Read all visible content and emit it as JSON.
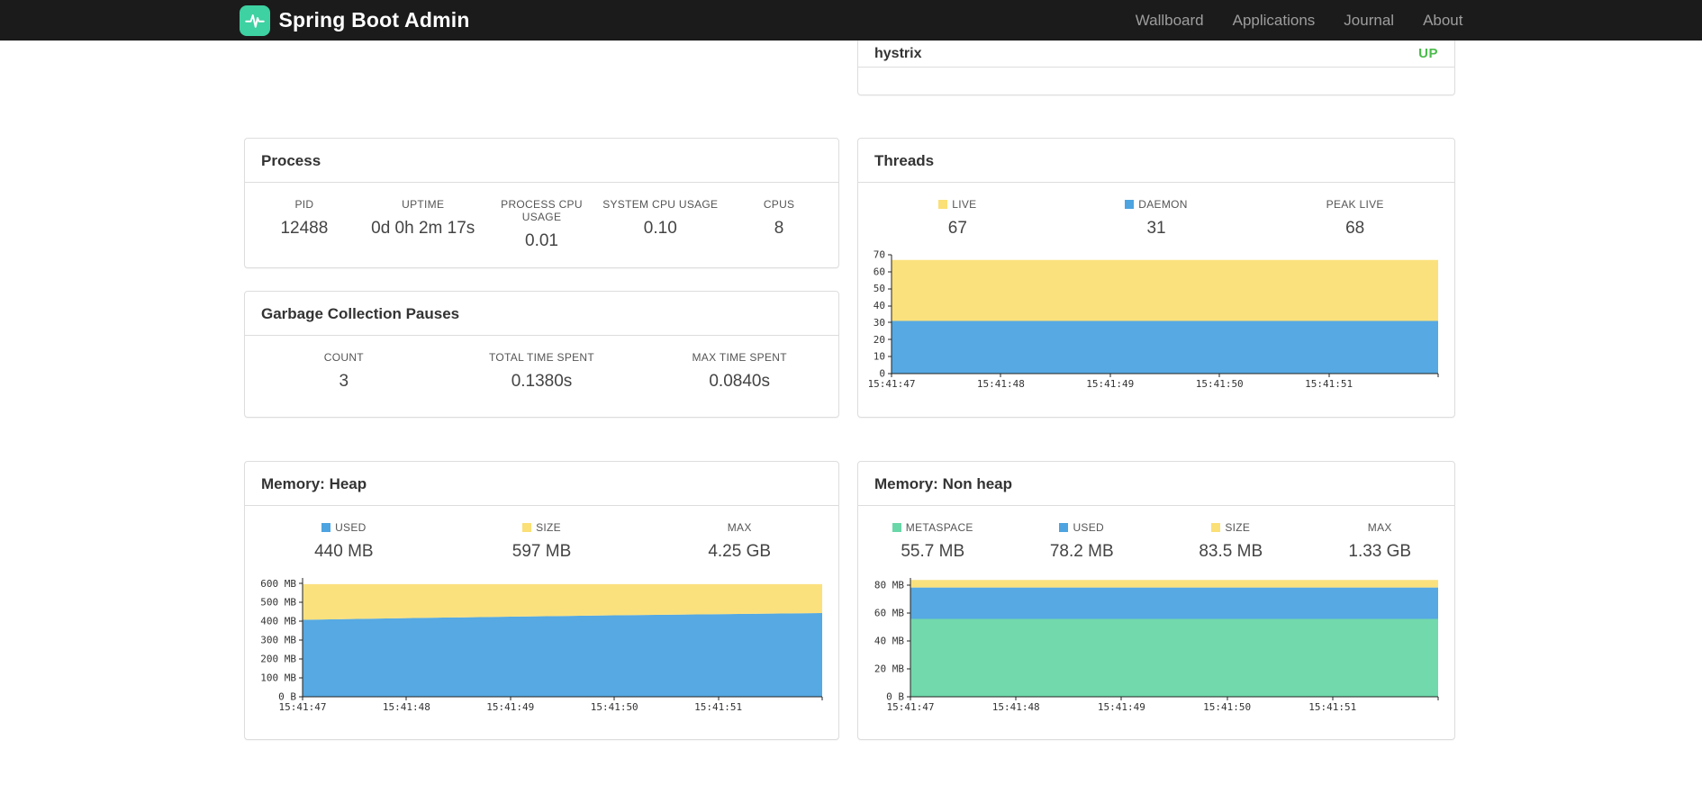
{
  "navbar": {
    "brand": "Spring Boot Admin",
    "items": [
      {
        "id": "wallboard",
        "label": "Wallboard"
      },
      {
        "id": "applications",
        "label": "Applications"
      },
      {
        "id": "journal",
        "label": "Journal"
      },
      {
        "id": "about",
        "label": "About"
      }
    ]
  },
  "colors": {
    "navbar_bg": "#1b1b1b",
    "brand_logo_green": "#3ED1A2",
    "status_up_green": "#4BBB4B",
    "series_blue": "#4DA4E0",
    "series_yellow": "#FBDF77",
    "series_green": "#69D7A8"
  },
  "application_status": {
    "app_name": "hystrix",
    "status": "UP"
  },
  "panels": {
    "process": {
      "title": "Process",
      "stats": [
        {
          "label": "PID",
          "value": "12488"
        },
        {
          "label": "UPTIME",
          "value": "0d 0h 2m 17s"
        },
        {
          "label": "PROCESS CPU USAGE",
          "value": "0.01"
        },
        {
          "label": "SYSTEM CPU USAGE",
          "value": "0.10"
        },
        {
          "label": "CPUS",
          "value": "8"
        }
      ]
    },
    "gc": {
      "title": "Garbage Collection Pauses",
      "stats": [
        {
          "label": "COUNT",
          "value": "3"
        },
        {
          "label": "TOTAL TIME SPENT",
          "value": "0.1380s"
        },
        {
          "label": "MAX TIME SPENT",
          "value": "0.0840s"
        }
      ]
    },
    "threads": {
      "title": "Threads",
      "stats": [
        {
          "label": "LIVE",
          "value": "67",
          "swatch_color": "#FBDF77"
        },
        {
          "label": "DAEMON",
          "value": "31",
          "swatch_color": "#4DA4E0"
        },
        {
          "label": "PEAK LIVE",
          "value": "68"
        }
      ]
    },
    "heap": {
      "title": "Memory: Heap",
      "stats": [
        {
          "label": "USED",
          "value": "440 MB",
          "swatch_color": "#4DA4E0"
        },
        {
          "label": "SIZE",
          "value": "597 MB",
          "swatch_color": "#FBDF77"
        },
        {
          "label": "MAX",
          "value": "4.25 GB"
        }
      ]
    },
    "nonheap": {
      "title": "Memory: Non heap",
      "stats": [
        {
          "label": "METASPACE",
          "value": "55.7 MB",
          "swatch_color": "#69D7A8"
        },
        {
          "label": "USED",
          "value": "78.2 MB",
          "swatch_color": "#4DA4E0"
        },
        {
          "label": "SIZE",
          "value": "83.5 MB",
          "swatch_color": "#FBDF77"
        },
        {
          "label": "MAX",
          "value": "1.33 GB"
        }
      ]
    }
  },
  "chart_data": [
    {
      "id": "threads",
      "type": "area",
      "title": "Threads",
      "stacked": true,
      "series_values_are": "stacked-tops",
      "x_labels": [
        "15:41:47",
        "15:41:48",
        "15:41:49",
        "15:41:50",
        "15:41:51",
        ""
      ],
      "series": [
        {
          "name": "DAEMON",
          "color": "#4DA4E0",
          "values": [
            31,
            31,
            31,
            31,
            31,
            31
          ]
        },
        {
          "name": "LIVE",
          "color": "#FBDF77",
          "values": [
            67,
            67,
            67,
            67,
            67,
            67
          ]
        }
      ],
      "ylim": [
        0,
        70
      ],
      "y_ticks": [
        {
          "value": 0,
          "label": "0"
        },
        {
          "value": 10,
          "label": "10"
        },
        {
          "value": 20,
          "label": "20"
        },
        {
          "value": 30,
          "label": "30"
        },
        {
          "value": 40,
          "label": "40"
        },
        {
          "value": 50,
          "label": "50"
        },
        {
          "value": 60,
          "label": "60"
        },
        {
          "value": 70,
          "label": "70"
        }
      ],
      "grid": false,
      "legend_position": "top"
    },
    {
      "id": "heap",
      "type": "area",
      "title": "Memory: Heap",
      "stacked": true,
      "series_values_are": "stacked-tops",
      "unit": "MB",
      "x_labels": [
        "15:41:47",
        "15:41:48",
        "15:41:49",
        "15:41:50",
        "15:41:51",
        ""
      ],
      "series": [
        {
          "name": "USED",
          "color": "#4DA4E0",
          "values": [
            408,
            417,
            425,
            432,
            438,
            444
          ]
        },
        {
          "name": "SIZE",
          "color": "#FBDF77",
          "values": [
            597,
            597,
            597,
            597,
            597,
            597
          ]
        }
      ],
      "ylim": [
        0,
        630
      ],
      "y_ticks": [
        {
          "value": 0,
          "label": "0 B"
        },
        {
          "value": 100,
          "label": "100 MB"
        },
        {
          "value": 200,
          "label": "200 MB"
        },
        {
          "value": 300,
          "label": "300 MB"
        },
        {
          "value": 400,
          "label": "400 MB"
        },
        {
          "value": 500,
          "label": "500 MB"
        },
        {
          "value": 600,
          "label": "600 MB"
        }
      ],
      "grid": false,
      "legend_position": "top"
    },
    {
      "id": "nonheap",
      "type": "area",
      "title": "Memory: Non heap",
      "stacked": true,
      "series_values_are": "stacked-tops",
      "unit": "MB",
      "x_labels": [
        "15:41:47",
        "15:41:48",
        "15:41:49",
        "15:41:50",
        "15:41:51",
        ""
      ],
      "series": [
        {
          "name": "METASPACE",
          "color": "#69D7A8",
          "values": [
            55.7,
            55.7,
            55.7,
            55.7,
            55.7,
            55.7
          ]
        },
        {
          "name": "USED",
          "color": "#4DA4E0",
          "values": [
            78.2,
            78.2,
            78.2,
            78.2,
            78.2,
            78.2
          ]
        },
        {
          "name": "SIZE",
          "color": "#FBDF77",
          "values": [
            83.5,
            83.5,
            83.5,
            83.5,
            83.5,
            83.5
          ]
        }
      ],
      "ylim": [
        0,
        85
      ],
      "y_ticks": [
        {
          "value": 0,
          "label": "0 B"
        },
        {
          "value": 20,
          "label": "20 MB"
        },
        {
          "value": 40,
          "label": "40 MB"
        },
        {
          "value": 60,
          "label": "60 MB"
        },
        {
          "value": 80,
          "label": "80 MB"
        }
      ],
      "grid": false,
      "legend_position": "top"
    }
  ]
}
